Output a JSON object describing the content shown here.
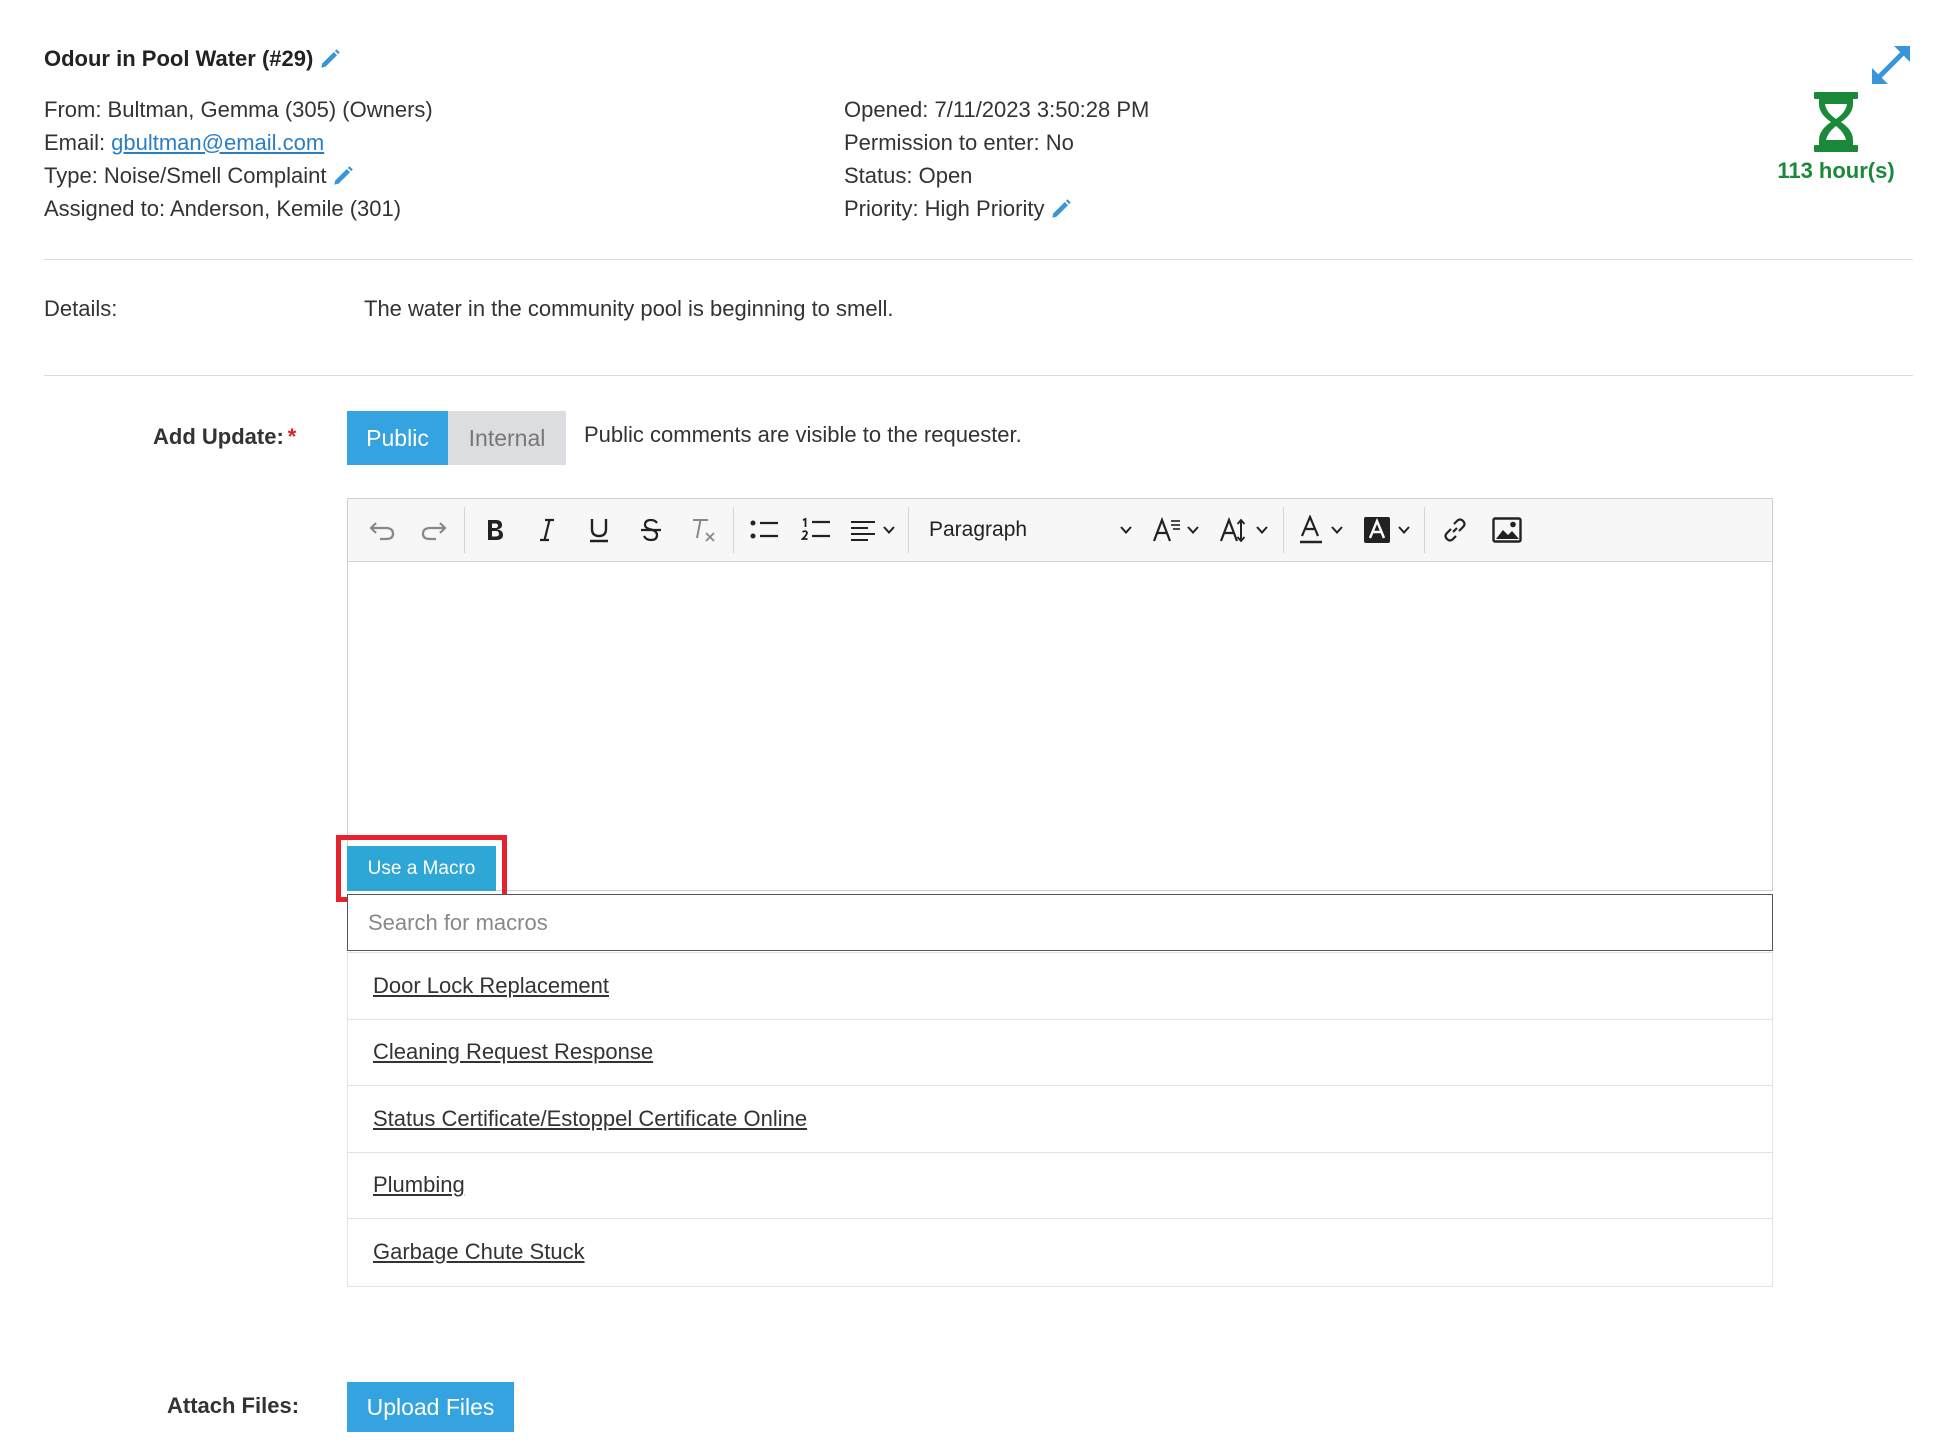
{
  "ticket": {
    "title": "Odour in Pool Water (#29)",
    "from": "From: Bultman, Gemma (305) (Owners)",
    "email_label": "Email:",
    "email": "gbultman@email.com",
    "type": "Type: Noise/Smell Complaint",
    "assigned": "Assigned to: Anderson, Kemile (301)",
    "opened": "Opened: 7/11/2023 3:50:28 PM",
    "permission": "Permission to enter: No",
    "status": "Status: Open",
    "priority": "Priority: High Priority",
    "timer": "113 hour(s)",
    "details_label": "Details:",
    "details": "The water in the community pool is beginning to smell."
  },
  "update": {
    "label": "Add Update:",
    "required_mark": "*",
    "public_label": "Public",
    "internal_label": "Internal",
    "hint": "Public comments are visible to the requester.",
    "block_format": "Paragraph"
  },
  "macros": {
    "button_label": "Use a Macro",
    "search_placeholder": "Search for macros",
    "items": [
      "Door Lock Replacement",
      "Cleaning Request Response",
      "Status Certificate/Estoppel Certificate Online",
      "Plumbing",
      "Garbage Chute Stuck"
    ]
  },
  "attach": {
    "label": "Attach Files:",
    "button_label": "Upload Files"
  },
  "colors": {
    "accent": "#35a3df",
    "timer_green": "#1a8a3a",
    "highlight_red": "#e5222d",
    "link_blue": "#2a7fc4"
  },
  "icons": [
    "edit-pencil-icon",
    "expand-icon",
    "hourglass-icon",
    "undo-icon",
    "redo-icon",
    "bold-icon",
    "italic-icon",
    "underline-icon",
    "strikethrough-icon",
    "clear-format-icon",
    "bullet-list-icon",
    "numbered-list-icon",
    "align-icon",
    "font-family-icon",
    "font-size-icon",
    "text-color-icon",
    "highlight-color-icon",
    "link-icon",
    "image-icon"
  ]
}
